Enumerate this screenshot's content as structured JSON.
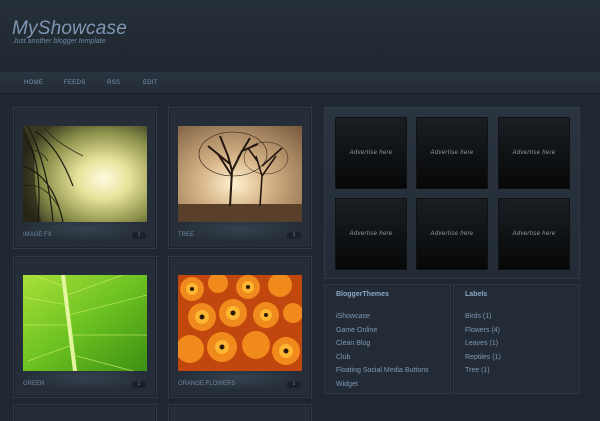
{
  "header": {
    "title": "MyShowcase",
    "tagline": "Just another blogger template"
  },
  "nav": {
    "items": [
      "HOME",
      "FEEDS",
      "RSS",
      "EDIT"
    ]
  },
  "tiles": [
    {
      "label": "IMAGE FX",
      "count": "1"
    },
    {
      "label": "TREE",
      "count": "1"
    },
    {
      "label": "GREEN",
      "count": "1"
    },
    {
      "label": "ORANGE FLOWERS",
      "count": "1"
    }
  ],
  "ads": {
    "text": "Advertise here"
  },
  "blogger_themes": {
    "title": "BloggerThemes",
    "items": [
      "iShowcase",
      "Game Online",
      "Clean Blog",
      "Club",
      "Floating Social Media Buttons",
      "Widget"
    ]
  },
  "labels": {
    "title": "Labels",
    "items": [
      "Birds (1)",
      "Flowers (4)",
      "Leaves (1)",
      "Reptiles (1)",
      "Tree (1)"
    ]
  }
}
